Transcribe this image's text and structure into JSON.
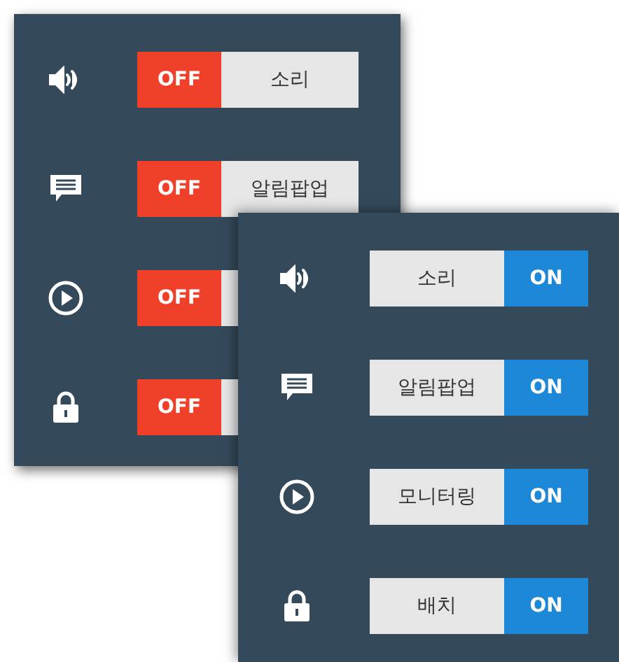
{
  "back_panel": {
    "settings": [
      {
        "kind": "sound",
        "state": "OFF",
        "on": false,
        "label": "소리"
      },
      {
        "kind": "message",
        "state": "OFF",
        "on": false,
        "label": "알림팝업"
      },
      {
        "kind": "play",
        "state": "OFF",
        "on": false
      },
      {
        "kind": "lock",
        "state": "OFF",
        "on": false
      }
    ]
  },
  "front_panel": {
    "settings": [
      {
        "kind": "sound",
        "state": "ON",
        "on": true,
        "label": "소리"
      },
      {
        "kind": "message",
        "state": "ON",
        "on": true,
        "label": "알림팝업"
      },
      {
        "kind": "play",
        "state": "ON",
        "on": true,
        "label": "모니터링"
      },
      {
        "kind": "lock",
        "state": "ON",
        "on": true,
        "label": "배치"
      }
    ]
  }
}
